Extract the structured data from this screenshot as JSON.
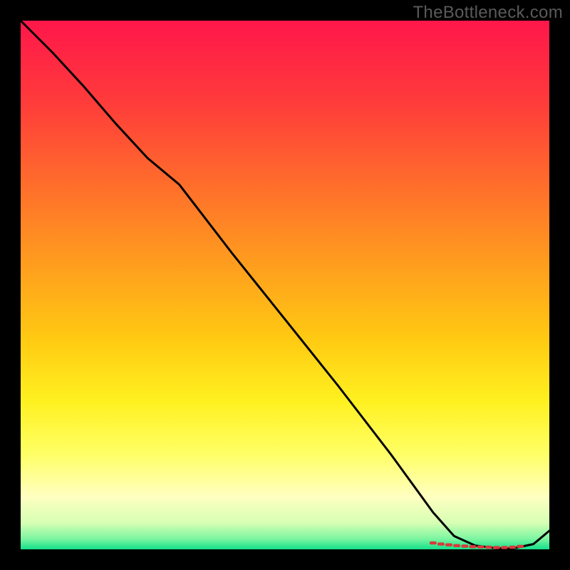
{
  "watermark": "TheBottleneck.com",
  "chart_data": {
    "type": "line",
    "title": "",
    "xlabel": "",
    "ylabel": "",
    "xlim": [
      0,
      100
    ],
    "ylim": [
      0,
      100
    ],
    "grid": false,
    "legend": false,
    "gradient_stops": [
      {
        "offset": 0.0,
        "color": "#ff174b"
      },
      {
        "offset": 0.15,
        "color": "#ff3a3b"
      },
      {
        "offset": 0.3,
        "color": "#ff6a2c"
      },
      {
        "offset": 0.45,
        "color": "#ff9a1f"
      },
      {
        "offset": 0.6,
        "color": "#ffc912"
      },
      {
        "offset": 0.72,
        "color": "#fff120"
      },
      {
        "offset": 0.82,
        "color": "#ffff66"
      },
      {
        "offset": 0.9,
        "color": "#ffffc0"
      },
      {
        "offset": 0.95,
        "color": "#d6ffb4"
      },
      {
        "offset": 0.98,
        "color": "#7cf5a1"
      },
      {
        "offset": 1.0,
        "color": "#15e08a"
      }
    ],
    "series": [
      {
        "name": "curve",
        "x": [
          0.0,
          6.0,
          12.0,
          18.0,
          24.0,
          30.0,
          40.0,
          50.0,
          60.0,
          70.0,
          78.0,
          82.0,
          86.0,
          90.0,
          93.0,
          97.0,
          100.0
        ],
        "y": [
          100.0,
          94.0,
          87.5,
          80.5,
          74.0,
          69.0,
          56.0,
          43.5,
          31.0,
          18.0,
          7.0,
          2.5,
          0.7,
          0.2,
          0.15,
          1.0,
          3.5
        ]
      }
    ],
    "markers": {
      "name": "highlight",
      "x": [
        78.0,
        79.5,
        81.0,
        82.5,
        84.0,
        85.5,
        87.0,
        88.5,
        90.0,
        91.5,
        93.0,
        94.5
      ],
      "y": [
        1.2,
        1.0,
        0.85,
        0.7,
        0.6,
        0.5,
        0.45,
        0.4,
        0.35,
        0.35,
        0.4,
        0.55
      ]
    }
  }
}
